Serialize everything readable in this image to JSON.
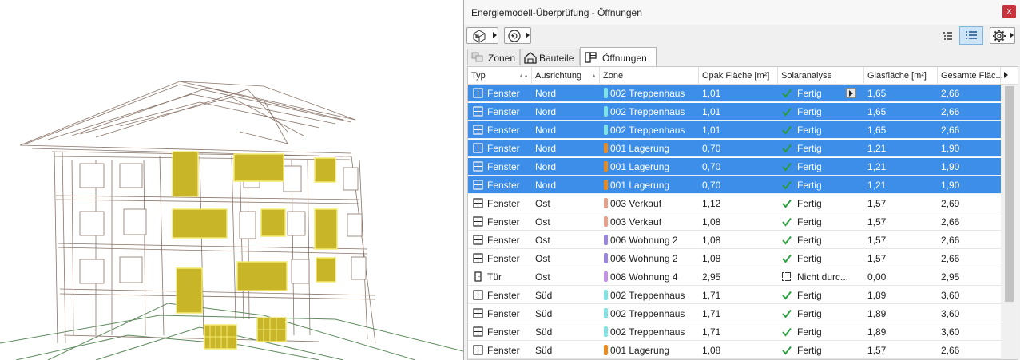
{
  "window": {
    "title": "Energiemodell-Überprüfung - Öffnungen",
    "close_label": "x"
  },
  "toolbar": {
    "left_buttons": [
      "model-icon",
      "refresh-icon"
    ],
    "right_buttons": [
      "tree-list-icon",
      "list-view-icon",
      "gear-icon"
    ]
  },
  "tabs": [
    {
      "label": "Zonen",
      "icon": "zone-icon"
    },
    {
      "label": "Bauteile",
      "icon": "house-icon"
    },
    {
      "label": "Öffnungen",
      "icon": "opening-icon",
      "active": true
    }
  ],
  "columns": [
    "Typ",
    "Ausrichtung",
    "Zone",
    "Opak Fläche [m²]",
    "Solaranalyse",
    "Glasfläche [m²]",
    "Gesamte Fläc..."
  ],
  "rows": [
    {
      "typ": "Fenster",
      "ausrichtung": "Nord",
      "zone": "002 Treppenhaus",
      "zone_color": "#7fe3e3",
      "opak": "1,01",
      "solar": "Fertig",
      "glas": "1,65",
      "gesamt": "2,66",
      "selected": true
    },
    {
      "typ": "Fenster",
      "ausrichtung": "Nord",
      "zone": "002 Treppenhaus",
      "zone_color": "#7fe3e3",
      "opak": "1,01",
      "solar": "Fertig",
      "glas": "1,65",
      "gesamt": "2,66",
      "selected": true
    },
    {
      "typ": "Fenster",
      "ausrichtung": "Nord",
      "zone": "002 Treppenhaus",
      "zone_color": "#7fe3e3",
      "opak": "1,01",
      "solar": "Fertig",
      "glas": "1,65",
      "gesamt": "2,66",
      "selected": true
    },
    {
      "typ": "Fenster",
      "ausrichtung": "Nord",
      "zone": "001 Lagerung",
      "zone_color": "#ee8a1b",
      "opak": "0,70",
      "solar": "Fertig",
      "glas": "1,21",
      "gesamt": "1,90",
      "selected": true
    },
    {
      "typ": "Fenster",
      "ausrichtung": "Nord",
      "zone": "001 Lagerung",
      "zone_color": "#ee8a1b",
      "opak": "0,70",
      "solar": "Fertig",
      "glas": "1,21",
      "gesamt": "1,90",
      "selected": true
    },
    {
      "typ": "Fenster",
      "ausrichtung": "Nord",
      "zone": "001 Lagerung",
      "zone_color": "#ee8a1b",
      "opak": "0,70",
      "solar": "Fertig",
      "glas": "1,21",
      "gesamt": "1,90",
      "selected": true
    },
    {
      "typ": "Fenster",
      "ausrichtung": "Ost",
      "zone": "003 Verkauf",
      "zone_color": "#e8a08a",
      "opak": "1,12",
      "solar": "Fertig",
      "glas": "1,57",
      "gesamt": "2,69",
      "selected": false
    },
    {
      "typ": "Fenster",
      "ausrichtung": "Ost",
      "zone": "003 Verkauf",
      "zone_color": "#e8a08a",
      "opak": "1,08",
      "solar": "Fertig",
      "glas": "1,57",
      "gesamt": "2,66",
      "selected": false
    },
    {
      "typ": "Fenster",
      "ausrichtung": "Ost",
      "zone": "006 Wohnung 2",
      "zone_color": "#9a86e0",
      "opak": "1,08",
      "solar": "Fertig",
      "glas": "1,57",
      "gesamt": "2,66",
      "selected": false
    },
    {
      "typ": "Fenster",
      "ausrichtung": "Ost",
      "zone": "006 Wohnung 2",
      "zone_color": "#9a86e0",
      "opak": "1,08",
      "solar": "Fertig",
      "glas": "1,57",
      "gesamt": "2,66",
      "selected": false
    },
    {
      "typ": "Tür",
      "ausrichtung": "Ost",
      "zone": "008 Wohnung 4",
      "zone_color": "#c490e8",
      "opak": "2,95",
      "solar": "Nicht durc...",
      "glas": "0,00",
      "gesamt": "2,95",
      "selected": false,
      "pending": true
    },
    {
      "typ": "Fenster",
      "ausrichtung": "Süd",
      "zone": "002 Treppenhaus",
      "zone_color": "#7fe3e3",
      "opak": "1,71",
      "solar": "Fertig",
      "glas": "1,89",
      "gesamt": "3,60",
      "selected": false
    },
    {
      "typ": "Fenster",
      "ausrichtung": "Süd",
      "zone": "002 Treppenhaus",
      "zone_color": "#7fe3e3",
      "opak": "1,71",
      "solar": "Fertig",
      "glas": "1,89",
      "gesamt": "3,60",
      "selected": false
    },
    {
      "typ": "Fenster",
      "ausrichtung": "Süd",
      "zone": "002 Treppenhaus",
      "zone_color": "#7fe3e3",
      "opak": "1,71",
      "solar": "Fertig",
      "glas": "1,89",
      "gesamt": "3,60",
      "selected": false
    },
    {
      "typ": "Fenster",
      "ausrichtung": "Süd",
      "zone": "001 Lagerung",
      "zone_color": "#ee8a1b",
      "opak": "1,08",
      "solar": "Fertig",
      "glas": "1,57",
      "gesamt": "2,66",
      "selected": false
    }
  ],
  "colors": {
    "selection": "#3d8ee8",
    "check_green": "#2ea043",
    "highlight_window": "#c9b628",
    "wireframe": "#8a7468",
    "ground": "#4f8a4f"
  }
}
